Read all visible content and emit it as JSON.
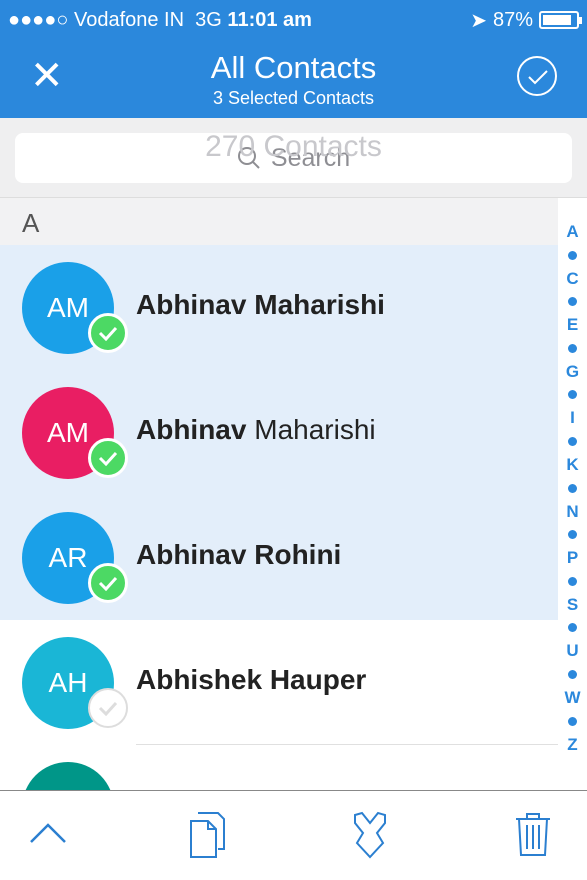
{
  "status": {
    "carrier": "●●●●○ Vodafone IN",
    "network": "3G",
    "time": "11:01 am",
    "battery": "87%",
    "battery_level": 0.87
  },
  "header": {
    "title": "All Contacts",
    "subtitle": "3 Selected Contacts",
    "close_icon": "close-icon",
    "done_icon": "check-circle-icon"
  },
  "search": {
    "placeholder": "Search",
    "background_count": "270 Contacts"
  },
  "section": "A",
  "contacts": [
    {
      "initials": "AM",
      "first": "Abhinav",
      "last": "Maharishi",
      "color": "#1aa0e8",
      "selected": true,
      "last_bold": true
    },
    {
      "initials": "AM",
      "first": "Abhinav",
      "last": "Maharishi",
      "color": "#e91e63",
      "selected": true,
      "last_bold": false
    },
    {
      "initials": "AR",
      "first": "Abhinav",
      "last": "Rohini",
      "color": "#1aa0e8",
      "selected": true,
      "last_bold": true
    },
    {
      "initials": "AH",
      "first": "Abhishek",
      "last": "Hauper",
      "color": "#1ab6d6",
      "selected": false,
      "last_bold": true
    },
    {
      "initials": "",
      "first": "",
      "last": "",
      "color": "#009688",
      "selected": false,
      "last_bold": true
    }
  ],
  "index": [
    "A",
    "•",
    "C",
    "•",
    "E",
    "•",
    "G",
    "•",
    "I",
    "•",
    "K",
    "•",
    "N",
    "•",
    "P",
    "•",
    "S",
    "•",
    "U",
    "•",
    "W",
    "•",
    "Z"
  ],
  "toolbar": [
    "chevron-up-icon",
    "copy-icon",
    "merge-icon",
    "trash-icon"
  ]
}
